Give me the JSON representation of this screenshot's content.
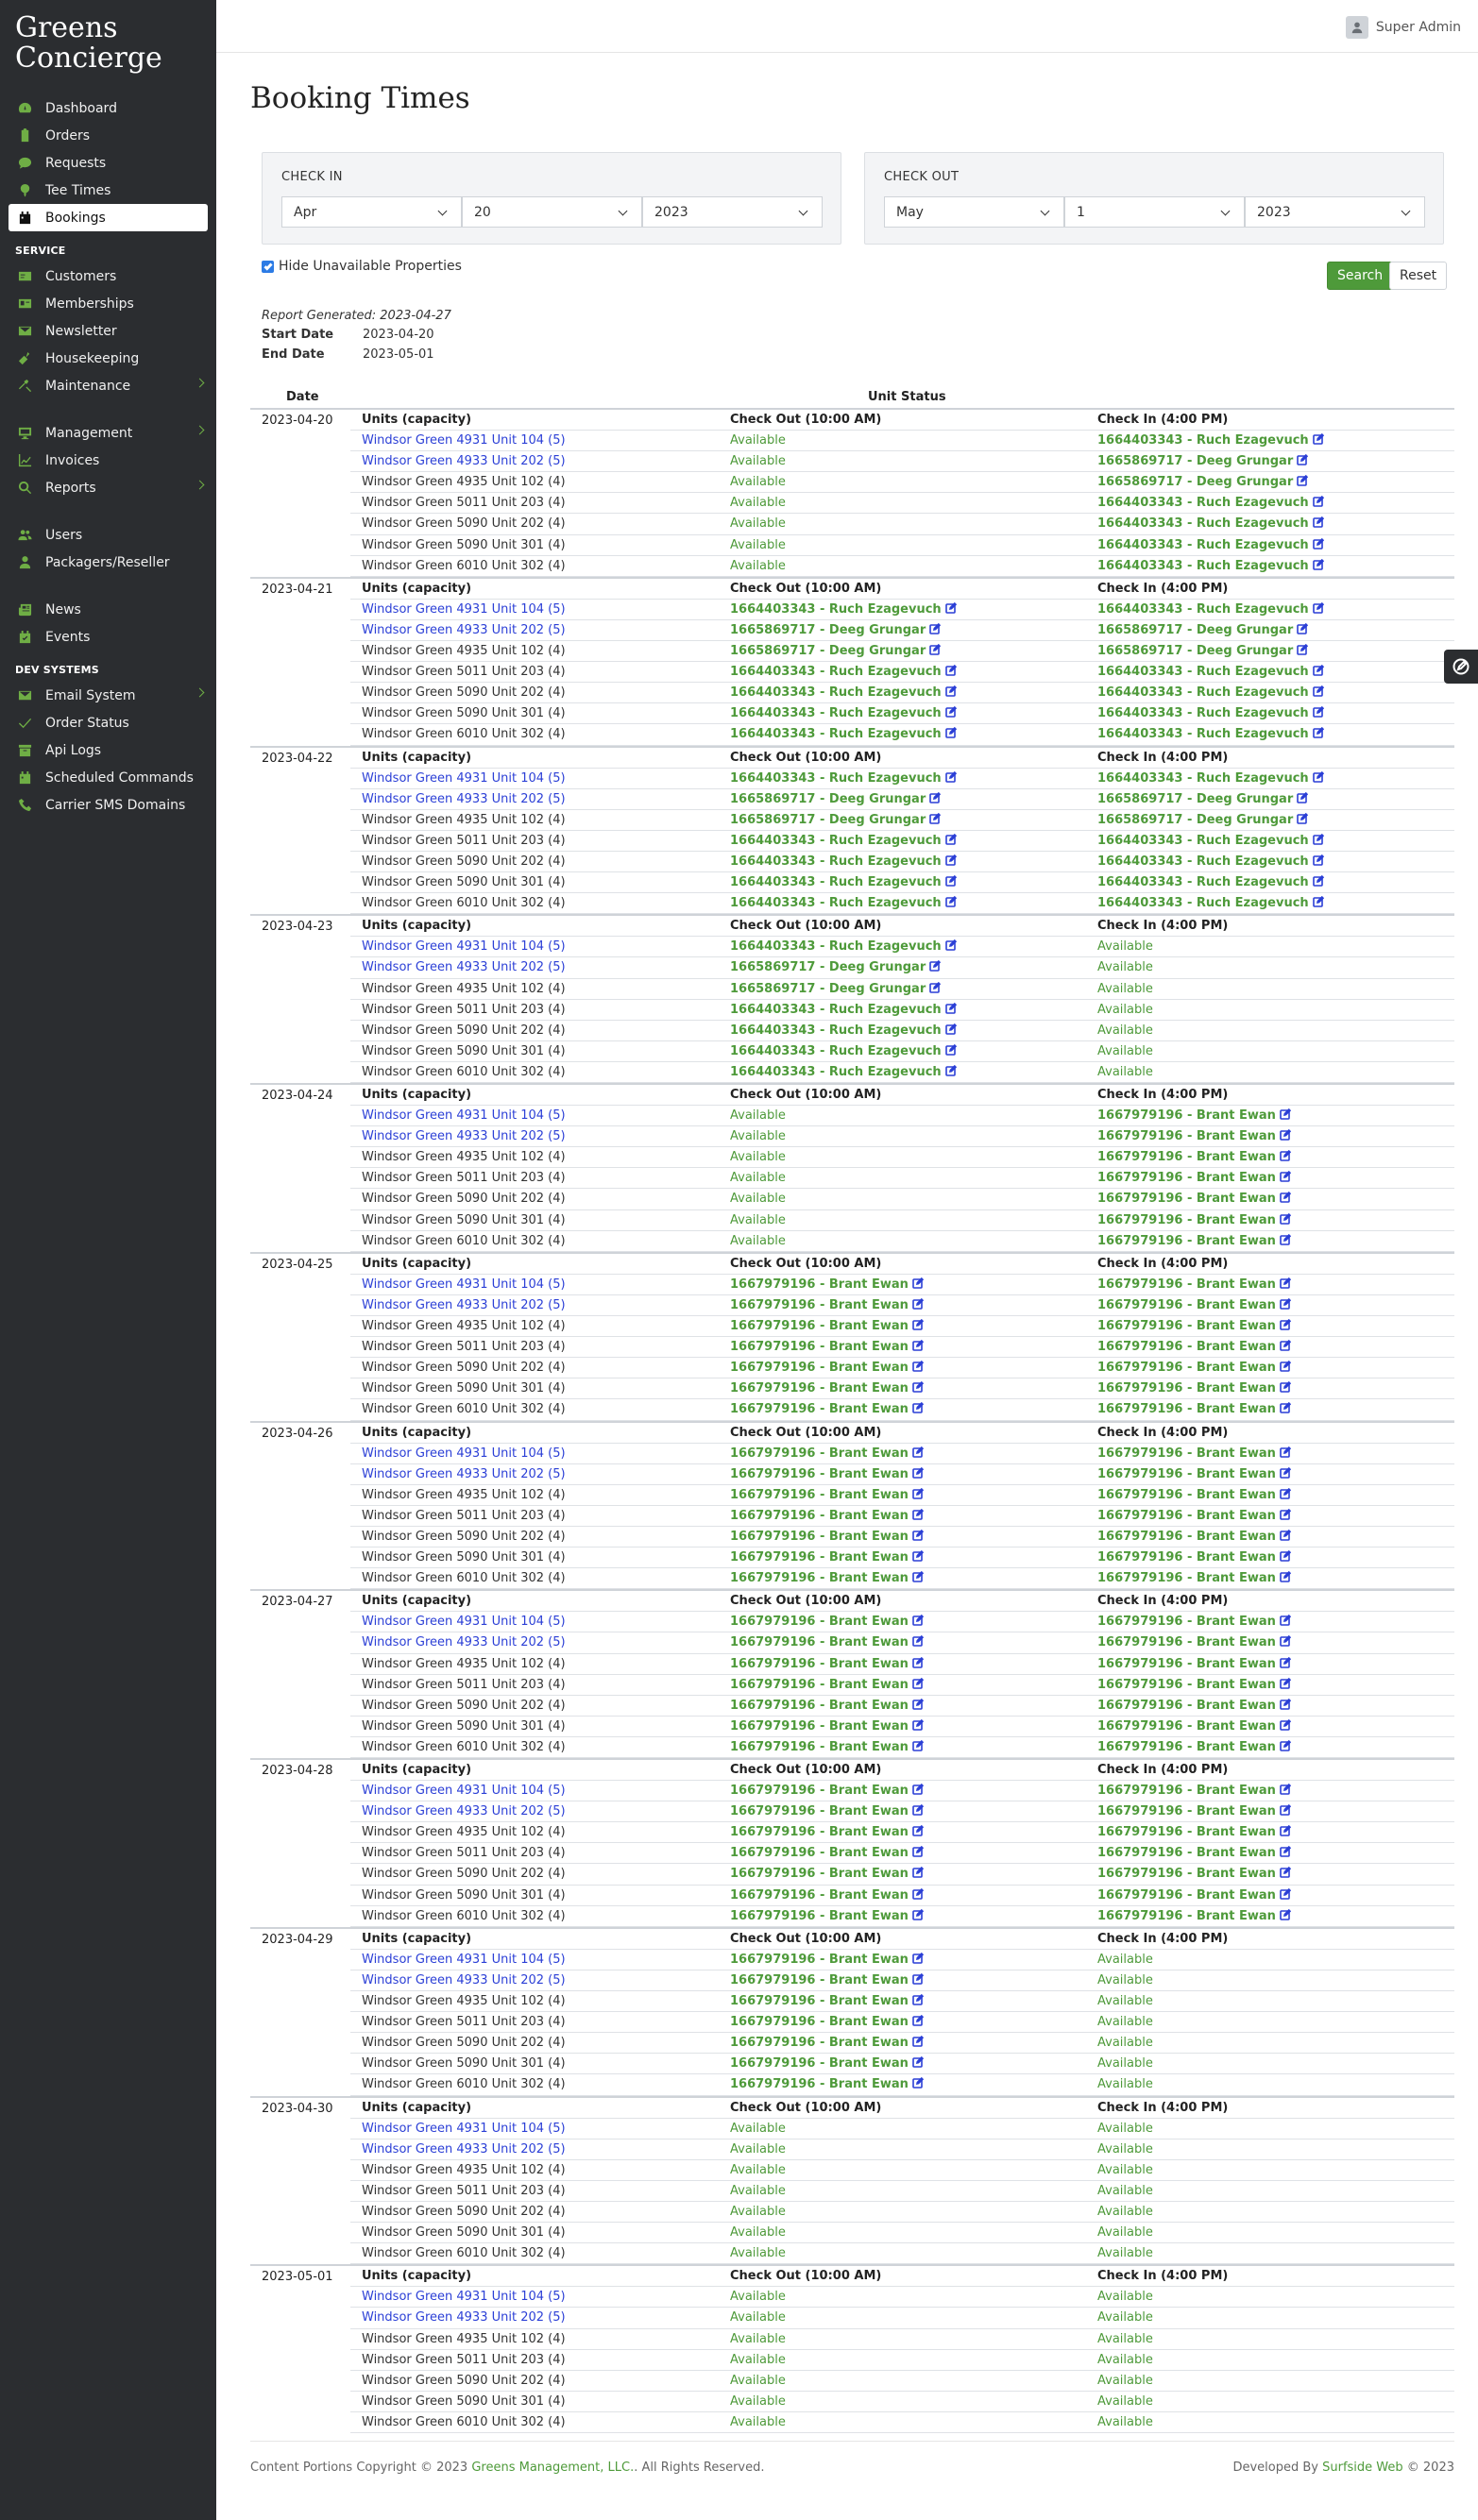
{
  "brand": {
    "line1": "Greens",
    "line2": "Concierge"
  },
  "nav_top": [
    {
      "label": "Dashboard",
      "icon": "dashboard-icon"
    },
    {
      "label": "Orders",
      "icon": "clipboard-icon"
    },
    {
      "label": "Requests",
      "icon": "chat-icon"
    },
    {
      "label": "Tee Times",
      "icon": "golf-tee-icon"
    },
    {
      "label": "Bookings",
      "icon": "calendar-icon",
      "active": true
    }
  ],
  "service_label": "SERVICE",
  "nav_service": [
    {
      "label": "Customers",
      "icon": "id-card-icon"
    },
    {
      "label": "Memberships",
      "icon": "id-badge-icon"
    },
    {
      "label": "Newsletter",
      "icon": "envelope-icon"
    },
    {
      "label": "Housekeeping",
      "icon": "broom-icon"
    },
    {
      "label": "Maintenance",
      "icon": "tools-icon",
      "chevron": true
    }
  ],
  "nav_manage": [
    {
      "label": "Management",
      "icon": "monitor-icon",
      "chevron": true
    },
    {
      "label": "Invoices",
      "icon": "chart-line-icon"
    },
    {
      "label": "Reports",
      "icon": "search-chart-icon",
      "chevron": true
    }
  ],
  "nav_people": [
    {
      "label": "Users",
      "icon": "users-icon"
    },
    {
      "label": "Packagers/Reseller",
      "icon": "user-tie-icon"
    }
  ],
  "nav_news": [
    {
      "label": "News",
      "icon": "newspaper-icon"
    },
    {
      "label": "Events",
      "icon": "calendar-check-icon"
    }
  ],
  "dev_label": "DEV SYSTEMS",
  "nav_dev": [
    {
      "label": "Email System",
      "icon": "envelope-icon",
      "chevron": true
    },
    {
      "label": "Order Status",
      "icon": "check-icon"
    },
    {
      "label": "Api Logs",
      "icon": "archive-icon"
    },
    {
      "label": "Scheduled Commands",
      "icon": "calendar-icon"
    },
    {
      "label": "Carrier SMS Domains",
      "icon": "phone-icon"
    }
  ],
  "user": {
    "name": "Super Admin",
    "icon": "user-icon"
  },
  "page_title": "Booking Times",
  "check_in": {
    "label": "CHECK IN",
    "month": "Apr",
    "day": "20",
    "year": "2023"
  },
  "check_out": {
    "label": "CHECK OUT",
    "month": "May",
    "day": "1",
    "year": "2023"
  },
  "hide_unavailable": {
    "label": "Hide Unavailable Properties",
    "checked": true
  },
  "buttons": {
    "search": "Search",
    "reset": "Reset"
  },
  "report": {
    "generated": "Report Generated: 2023-04-27",
    "start_label": "Start Date",
    "start_value": "2023-04-20",
    "end_label": "End Date",
    "end_value": "2023-05-01"
  },
  "table": {
    "col_date": "Date",
    "col_status": "Unit Status",
    "units_header": "Units (capacity)",
    "checkout_header": "Check Out (10:00 AM)",
    "checkin_header": "Check In (4:00 PM)",
    "units": [
      {
        "name": "Windsor Green 4931 Unit 104 (5)",
        "link": true
      },
      {
        "name": "Windsor Green 4933 Unit 202 (5)",
        "link": true
      },
      {
        "name": "Windsor Green 4935 Unit 102 (4)",
        "link": false
      },
      {
        "name": "Windsor Green 5011 Unit 203 (4)",
        "link": false
      },
      {
        "name": "Windsor Green 5090 Unit 202 (4)",
        "link": false
      },
      {
        "name": "Windsor Green 5090 Unit 301 (4)",
        "link": false
      },
      {
        "name": "Windsor Green 6010 Unit 302 (4)",
        "link": false
      }
    ],
    "available_text": "Available",
    "days": [
      {
        "date": "2023-04-20",
        "checkout": [
          "Available",
          "Available",
          "Available",
          "Available",
          "Available",
          "Available",
          "Available"
        ],
        "checkin": [
          "1664403343 - Ruch Ezagevuch",
          "1665869717 - Deeg Grungar",
          "1665869717 - Deeg Grungar",
          "1664403343 - Ruch Ezagevuch",
          "1664403343 - Ruch Ezagevuch",
          "1664403343 - Ruch Ezagevuch",
          "1664403343 - Ruch Ezagevuch"
        ]
      },
      {
        "date": "2023-04-21",
        "checkout": [
          "1664403343 - Ruch Ezagevuch",
          "1665869717 - Deeg Grungar",
          "1665869717 - Deeg Grungar",
          "1664403343 - Ruch Ezagevuch",
          "1664403343 - Ruch Ezagevuch",
          "1664403343 - Ruch Ezagevuch",
          "1664403343 - Ruch Ezagevuch"
        ],
        "checkin": [
          "1664403343 - Ruch Ezagevuch",
          "1665869717 - Deeg Grungar",
          "1665869717 - Deeg Grungar",
          "1664403343 - Ruch Ezagevuch",
          "1664403343 - Ruch Ezagevuch",
          "1664403343 - Ruch Ezagevuch",
          "1664403343 - Ruch Ezagevuch"
        ]
      },
      {
        "date": "2023-04-22",
        "checkout": [
          "1664403343 - Ruch Ezagevuch",
          "1665869717 - Deeg Grungar",
          "1665869717 - Deeg Grungar",
          "1664403343 - Ruch Ezagevuch",
          "1664403343 - Ruch Ezagevuch",
          "1664403343 - Ruch Ezagevuch",
          "1664403343 - Ruch Ezagevuch"
        ],
        "checkin": [
          "1664403343 - Ruch Ezagevuch",
          "1665869717 - Deeg Grungar",
          "1665869717 - Deeg Grungar",
          "1664403343 - Ruch Ezagevuch",
          "1664403343 - Ruch Ezagevuch",
          "1664403343 - Ruch Ezagevuch",
          "1664403343 - Ruch Ezagevuch"
        ]
      },
      {
        "date": "2023-04-23",
        "checkout": [
          "1664403343 - Ruch Ezagevuch",
          "1665869717 - Deeg Grungar",
          "1665869717 - Deeg Grungar",
          "1664403343 - Ruch Ezagevuch",
          "1664403343 - Ruch Ezagevuch",
          "1664403343 - Ruch Ezagevuch",
          "1664403343 - Ruch Ezagevuch"
        ],
        "checkin": [
          "Available",
          "Available",
          "Available",
          "Available",
          "Available",
          "Available",
          "Available"
        ]
      },
      {
        "date": "2023-04-24",
        "checkout": [
          "Available",
          "Available",
          "Available",
          "Available",
          "Available",
          "Available",
          "Available"
        ],
        "checkin": [
          "1667979196 - Brant Ewan",
          "1667979196 - Brant Ewan",
          "1667979196 - Brant Ewan",
          "1667979196 - Brant Ewan",
          "1667979196 - Brant Ewan",
          "1667979196 - Brant Ewan",
          "1667979196 - Brant Ewan"
        ]
      },
      {
        "date": "2023-04-25",
        "checkout": [
          "1667979196 - Brant Ewan",
          "1667979196 - Brant Ewan",
          "1667979196 - Brant Ewan",
          "1667979196 - Brant Ewan",
          "1667979196 - Brant Ewan",
          "1667979196 - Brant Ewan",
          "1667979196 - Brant Ewan"
        ],
        "checkin": [
          "1667979196 - Brant Ewan",
          "1667979196 - Brant Ewan",
          "1667979196 - Brant Ewan",
          "1667979196 - Brant Ewan",
          "1667979196 - Brant Ewan",
          "1667979196 - Brant Ewan",
          "1667979196 - Brant Ewan"
        ]
      },
      {
        "date": "2023-04-26",
        "checkout": [
          "1667979196 - Brant Ewan",
          "1667979196 - Brant Ewan",
          "1667979196 - Brant Ewan",
          "1667979196 - Brant Ewan",
          "1667979196 - Brant Ewan",
          "1667979196 - Brant Ewan",
          "1667979196 - Brant Ewan"
        ],
        "checkin": [
          "1667979196 - Brant Ewan",
          "1667979196 - Brant Ewan",
          "1667979196 - Brant Ewan",
          "1667979196 - Brant Ewan",
          "1667979196 - Brant Ewan",
          "1667979196 - Brant Ewan",
          "1667979196 - Brant Ewan"
        ]
      },
      {
        "date": "2023-04-27",
        "checkout": [
          "1667979196 - Brant Ewan",
          "1667979196 - Brant Ewan",
          "1667979196 - Brant Ewan",
          "1667979196 - Brant Ewan",
          "1667979196 - Brant Ewan",
          "1667979196 - Brant Ewan",
          "1667979196 - Brant Ewan"
        ],
        "checkin": [
          "1667979196 - Brant Ewan",
          "1667979196 - Brant Ewan",
          "1667979196 - Brant Ewan",
          "1667979196 - Brant Ewan",
          "1667979196 - Brant Ewan",
          "1667979196 - Brant Ewan",
          "1667979196 - Brant Ewan"
        ]
      },
      {
        "date": "2023-04-28",
        "checkout": [
          "1667979196 - Brant Ewan",
          "1667979196 - Brant Ewan",
          "1667979196 - Brant Ewan",
          "1667979196 - Brant Ewan",
          "1667979196 - Brant Ewan",
          "1667979196 - Brant Ewan",
          "1667979196 - Brant Ewan"
        ],
        "checkin": [
          "1667979196 - Brant Ewan",
          "1667979196 - Brant Ewan",
          "1667979196 - Brant Ewan",
          "1667979196 - Brant Ewan",
          "1667979196 - Brant Ewan",
          "1667979196 - Brant Ewan",
          "1667979196 - Brant Ewan"
        ]
      },
      {
        "date": "2023-04-29",
        "checkout": [
          "1667979196 - Brant Ewan",
          "1667979196 - Brant Ewan",
          "1667979196 - Brant Ewan",
          "1667979196 - Brant Ewan",
          "1667979196 - Brant Ewan",
          "1667979196 - Brant Ewan",
          "1667979196 - Brant Ewan"
        ],
        "checkin": [
          "Available",
          "Available",
          "Available",
          "Available",
          "Available",
          "Available",
          "Available"
        ]
      },
      {
        "date": "2023-04-30",
        "checkout": [
          "Available",
          "Available",
          "Available",
          "Available",
          "Available",
          "Available",
          "Available"
        ],
        "checkin": [
          "Available",
          "Available",
          "Available",
          "Available",
          "Available",
          "Available",
          "Available"
        ]
      },
      {
        "date": "2023-05-01",
        "checkout": [
          "Available",
          "Available",
          "Available",
          "Available",
          "Available",
          "Available",
          "Available"
        ],
        "checkin": [
          "Available",
          "Available",
          "Available",
          "Available",
          "Available",
          "Available",
          "Available"
        ]
      }
    ]
  },
  "footer": {
    "copyright_prefix": "Content Portions Copyright © 2023",
    "company": "Greens Management, LLC.",
    "rights": "All Rights Reserved.",
    "dev_prefix": "Developed By",
    "dev_company": "Surfside Web",
    "dev_year": "© 2023"
  },
  "colors": {
    "sidebar_bg": "#2b2d30",
    "accent_green": "#4e9a3a",
    "link_blue": "#2b3fd6"
  }
}
